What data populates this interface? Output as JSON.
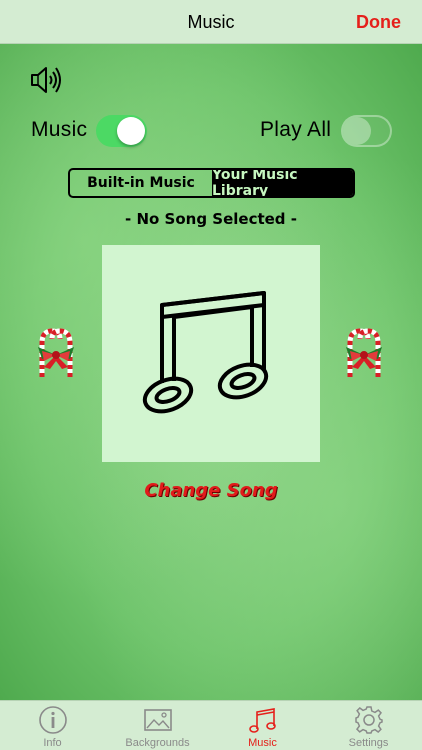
{
  "navbar": {
    "title": "Music",
    "done_label": "Done"
  },
  "controls": {
    "music_label": "Music",
    "music_on": true,
    "play_all_label": "Play All",
    "play_all_on": false
  },
  "source_selector": {
    "options": [
      "Built-in Music",
      "Your Music Library"
    ],
    "selected": "Your Music Library"
  },
  "song_status": "- No Song Selected -",
  "change_song_label": "Change Song",
  "tabs": [
    {
      "label": "Info",
      "icon": "info-icon",
      "active": false
    },
    {
      "label": "Backgrounds",
      "icon": "image-icon",
      "active": false
    },
    {
      "label": "Music",
      "icon": "music-note-icon",
      "active": true
    },
    {
      "label": "Settings",
      "icon": "gear-icon",
      "active": false
    }
  ],
  "colors": {
    "accent": "#e5201b",
    "switch_on": "#4cd964",
    "background": "#6cc06a",
    "bar": "#d4ecd2"
  }
}
